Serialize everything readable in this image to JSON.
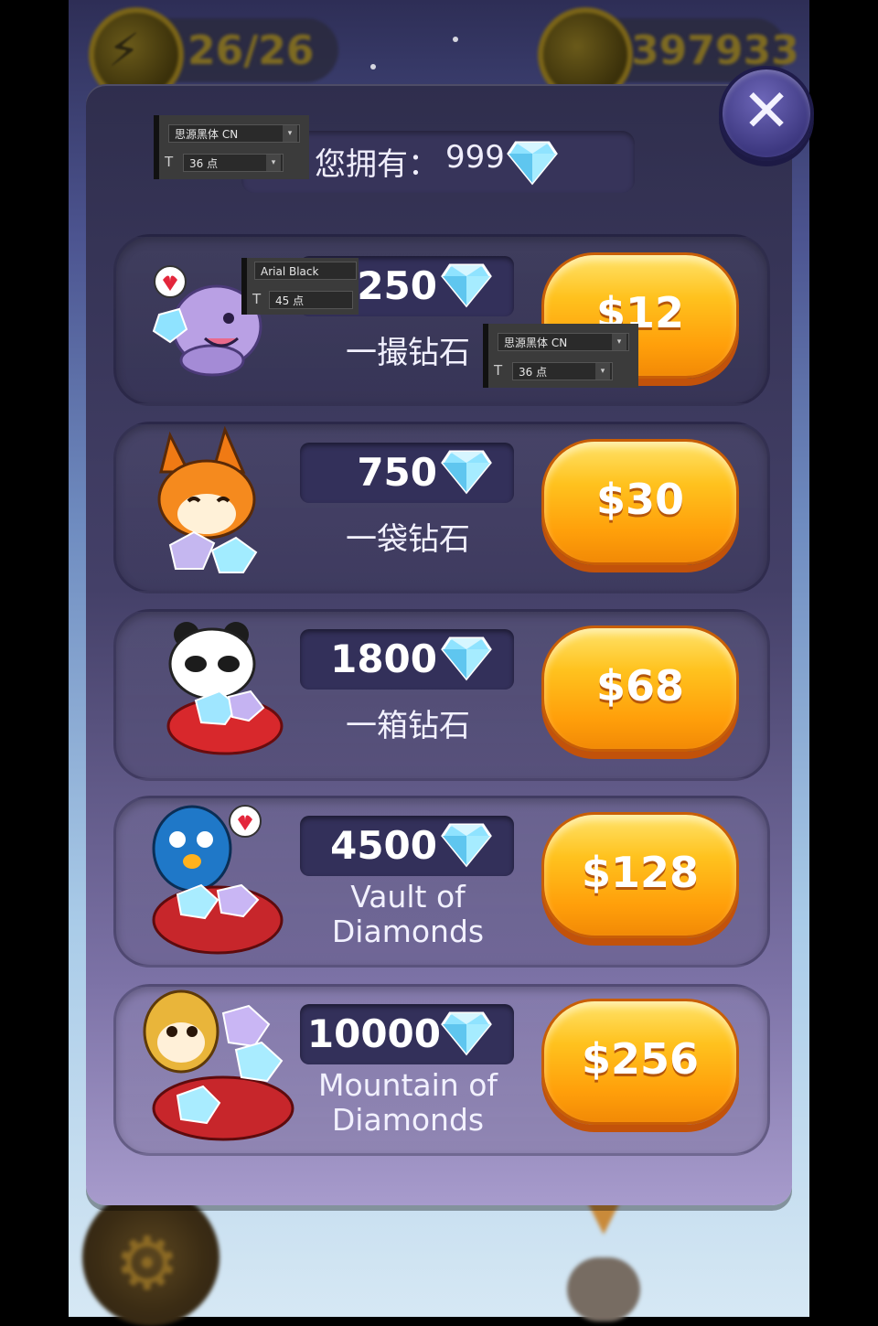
{
  "hud": {
    "energy": "26/26",
    "diamonds": "397933"
  },
  "close_label": "✕",
  "owned": {
    "label": "您拥有：",
    "value": "999"
  },
  "packages": [
    {
      "amount": "250",
      "name": "一撮钻石",
      "price": "$12"
    },
    {
      "amount": "750",
      "name": "一袋钻石",
      "price": "$30"
    },
    {
      "amount": "1800",
      "name": "一箱钻石",
      "price": "$68"
    },
    {
      "amount": "4500",
      "name": "Vault of Diamonds",
      "price": "$128"
    },
    {
      "amount": "10000",
      "name": "Mountain of Diamonds",
      "price": "$256"
    }
  ],
  "ps_overlays": [
    {
      "font": "思源黑体 CN",
      "size": "36 点"
    },
    {
      "font": "Arial Black",
      "size": "45 点"
    },
    {
      "font": "思源黑体 CN",
      "size": "36 点"
    }
  ],
  "colors": {
    "button": "#ffb214",
    "modal": "#3e3b63",
    "diamond": "#8fe3ff"
  }
}
